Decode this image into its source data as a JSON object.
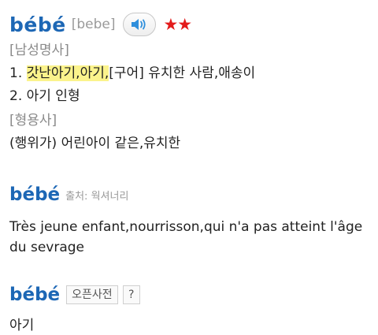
{
  "entry1": {
    "word": "bébé",
    "pronunciation": "[bebe]",
    "stars": "★★",
    "pos1": "[남성명사]",
    "def1_num": "1. ",
    "def1_highlight": "갓난아기,아기,",
    "def1_rest": "[구어] 유치한 사람,애송이",
    "def2": "2. 아기 인형",
    "pos2": "[형용사]",
    "def3": "(행위가) 어린아이 같은,유치한"
  },
  "entry2": {
    "word": "bébé",
    "source": "출처: 웍셔너리",
    "definition": "Très jeune enfant,nourrisson,qui n'a pas atteint l'âge du sevrage"
  },
  "entry3": {
    "word": "bébé",
    "dict_button": "오픈사전",
    "help_button": "?",
    "meaning": "아기"
  },
  "colors": {
    "headword": "#1d67b5",
    "stars": "#e31b1b",
    "highlight": "#fbf38c",
    "speaker": "#2f8fdc"
  }
}
